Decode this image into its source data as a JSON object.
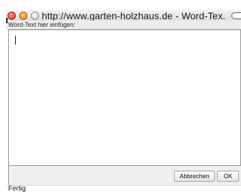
{
  "window": {
    "title": "http://www.garten-holzhaus.de - Word-Tex..."
  },
  "form": {
    "label": "Word-Text hier einfügen:",
    "textarea_value": ""
  },
  "buttons": {
    "cancel_label": "Abbrechen",
    "ok_label": "OK"
  },
  "status": {
    "text": "Fertig"
  },
  "icons": [
    "close-icon",
    "minimize-icon",
    "zoom-icon",
    "toolbar-toggle-icon"
  ]
}
